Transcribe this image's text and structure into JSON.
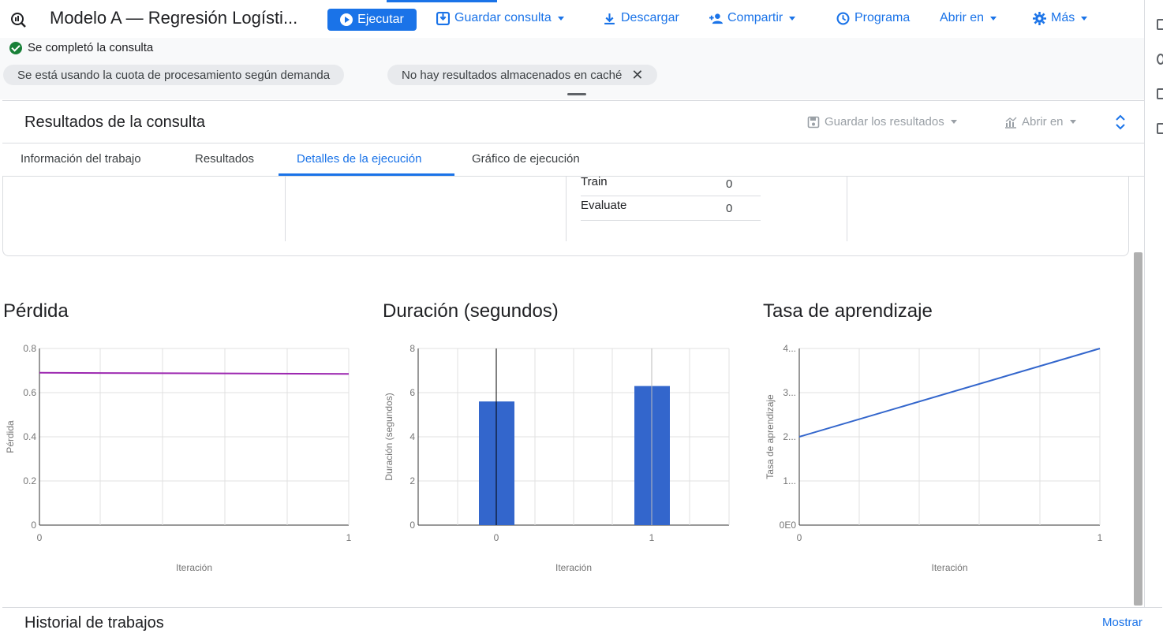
{
  "toolbar": {
    "title": "Modelo A — Regresión Logísti...",
    "run_label": "Ejecutar",
    "save_query_label": "Guardar consulta",
    "download_label": "Descargar",
    "share_label": "Compartir",
    "schedule_label": "Programa",
    "open_in_label": "Abrir en",
    "more_label": "Más"
  },
  "status": {
    "message": "Se completó la consulta",
    "chip_quota": "Se está usando la cuota de procesamiento según demanda",
    "chip_cache": "No hay resultados almacenados en caché",
    "chip_close": "✕"
  },
  "results": {
    "title": "Resultados de la consulta",
    "save_results_label": "Guardar los resultados",
    "open_in_label": "Abrir en"
  },
  "tabs": [
    {
      "label": "Información del trabajo",
      "active": false
    },
    {
      "label": "Resultados",
      "active": false
    },
    {
      "label": "Detalles de la ejecución",
      "active": true
    },
    {
      "label": "Gráfico de ejecución",
      "active": false
    }
  ],
  "details": {
    "rows": [
      {
        "key": "Train",
        "value": "0"
      },
      {
        "key": "Evaluate",
        "value": "0"
      }
    ]
  },
  "history": {
    "title": "Historial de trabajos",
    "show_label": "Mostrar"
  },
  "colors": {
    "accent": "#1a73e8",
    "success": "#188038",
    "loss_line": "#9c27b0",
    "duration_bar": "#3366cc",
    "lr_line": "#3366cc"
  },
  "chart_data": [
    {
      "type": "line",
      "title": "Pérdida",
      "xlabel": "Iteración",
      "ylabel": "Pérdida",
      "x": [
        0,
        1
      ],
      "series": [
        {
          "values": [
            0.69,
            0.685
          ]
        }
      ],
      "xlim": [
        0,
        1
      ],
      "ylim": [
        0,
        0.8
      ],
      "xticks": [
        "0",
        "1"
      ],
      "yticks": [
        "0",
        "0.2",
        "0.4",
        "0.6",
        "0.8"
      ],
      "grid": true
    },
    {
      "type": "bar",
      "title": "Duración (segundos)",
      "xlabel": "Iteración",
      "ylabel": "Duración (segundos)",
      "categories": [
        "0",
        "1"
      ],
      "values": [
        5.6,
        6.3
      ],
      "ylim": [
        0,
        8
      ],
      "yticks": [
        "0",
        "2",
        "4",
        "6",
        "8"
      ],
      "grid": true
    },
    {
      "type": "line",
      "title": "Tasa de aprendizaje",
      "xlabel": "Iteración",
      "ylabel": "Tasa de aprendizaje",
      "x": [
        0,
        1
      ],
      "series": [
        {
          "values": [
            2,
            4
          ]
        }
      ],
      "xlim": [
        0,
        1
      ],
      "ylim": [
        0,
        4
      ],
      "xticks": [
        "0",
        "1"
      ],
      "yticks": [
        "0E0",
        "1...",
        "2...",
        "3...",
        "4..."
      ],
      "grid": true
    }
  ]
}
